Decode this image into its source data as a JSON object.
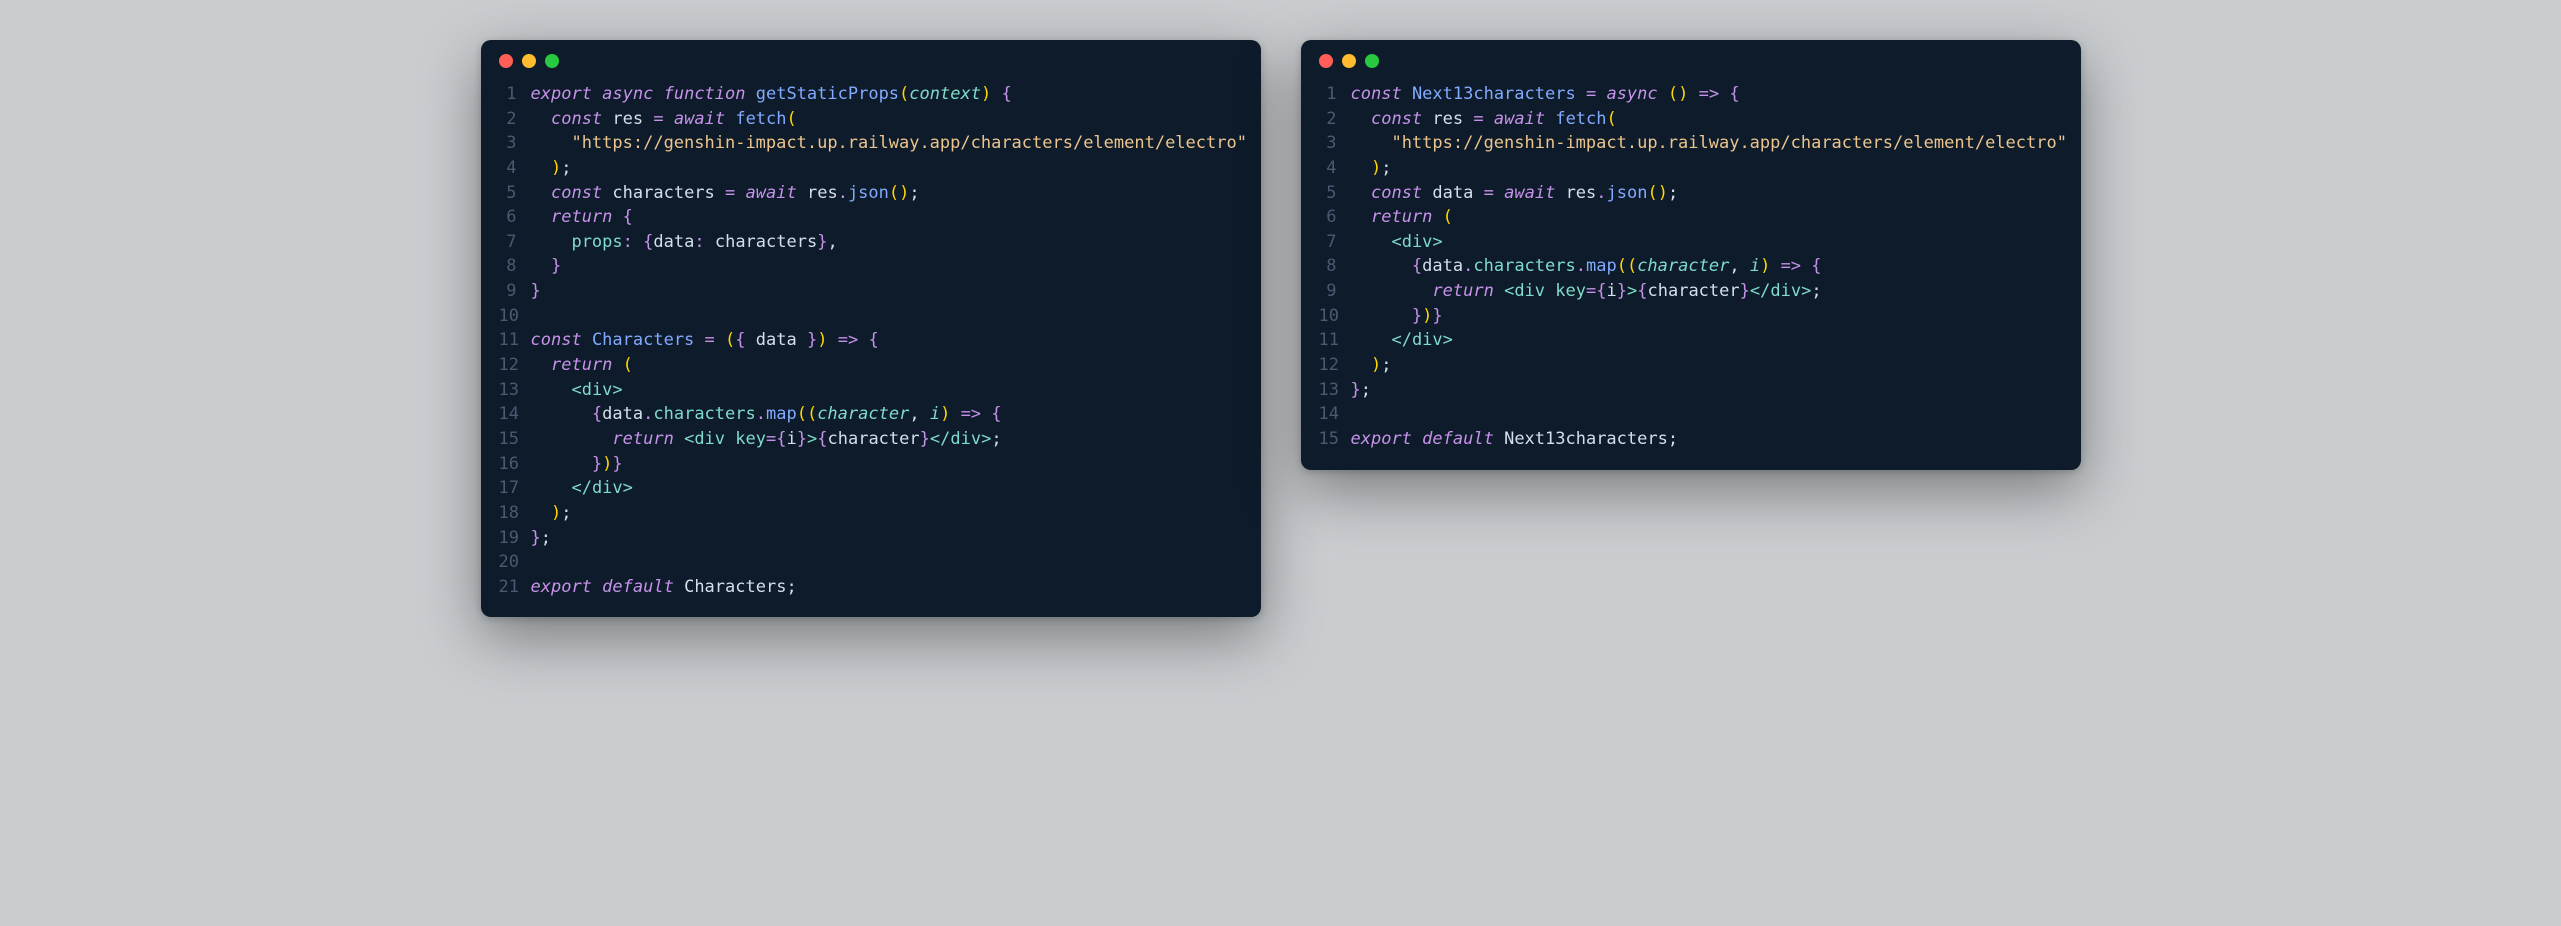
{
  "left": {
    "lines": [
      {
        "n": "1",
        "tokens": [
          [
            "kw",
            "export"
          ],
          [
            "white",
            " "
          ],
          [
            "kw",
            "async"
          ],
          [
            "white",
            " "
          ],
          [
            "kw",
            "function"
          ],
          [
            "white",
            " "
          ],
          [
            "fn",
            "getStaticProps"
          ],
          [
            "paren",
            "("
          ],
          [
            "param",
            "context"
          ],
          [
            "paren",
            ")"
          ],
          [
            "white",
            " "
          ],
          [
            "punc",
            "{"
          ]
        ]
      },
      {
        "n": "2",
        "tokens": [
          [
            "white",
            "  "
          ],
          [
            "kw",
            "const"
          ],
          [
            "white",
            " "
          ],
          [
            "var",
            "res"
          ],
          [
            "white",
            " "
          ],
          [
            "op",
            "="
          ],
          [
            "white",
            " "
          ],
          [
            "kw",
            "await"
          ],
          [
            "white",
            " "
          ],
          [
            "fn",
            "fetch"
          ],
          [
            "paren",
            "("
          ]
        ]
      },
      {
        "n": "3",
        "tokens": [
          [
            "white",
            "    "
          ],
          [
            "str",
            "\"https://genshin-impact.up.railway.app/characters/element/electro\""
          ]
        ]
      },
      {
        "n": "4",
        "tokens": [
          [
            "white",
            "  "
          ],
          [
            "paren",
            ")"
          ],
          [
            "semi",
            ";"
          ]
        ]
      },
      {
        "n": "5",
        "tokens": [
          [
            "white",
            "  "
          ],
          [
            "kw",
            "const"
          ],
          [
            "white",
            " "
          ],
          [
            "var",
            "characters"
          ],
          [
            "white",
            " "
          ],
          [
            "op",
            "="
          ],
          [
            "white",
            " "
          ],
          [
            "kw",
            "await"
          ],
          [
            "white",
            " "
          ],
          [
            "var",
            "res"
          ],
          [
            "dot2",
            "."
          ],
          [
            "fn",
            "json"
          ],
          [
            "paren",
            "()"
          ],
          [
            "semi",
            ";"
          ]
        ]
      },
      {
        "n": "6",
        "tokens": [
          [
            "white",
            "  "
          ],
          [
            "kw",
            "return"
          ],
          [
            "white",
            " "
          ],
          [
            "punc",
            "{"
          ]
        ]
      },
      {
        "n": "7",
        "tokens": [
          [
            "white",
            "    "
          ],
          [
            "prop",
            "props"
          ],
          [
            "punc",
            ":"
          ],
          [
            "white",
            " "
          ],
          [
            "punc",
            "{"
          ],
          [
            "var",
            "data"
          ],
          [
            "punc",
            ":"
          ],
          [
            "white",
            " "
          ],
          [
            "var",
            "characters"
          ],
          [
            "punc",
            "}"
          ],
          [
            "semi",
            ","
          ]
        ]
      },
      {
        "n": "8",
        "tokens": [
          [
            "white",
            "  "
          ],
          [
            "punc",
            "}"
          ]
        ]
      },
      {
        "n": "9",
        "tokens": [
          [
            "punc",
            "}"
          ]
        ]
      },
      {
        "n": "10",
        "tokens": []
      },
      {
        "n": "11",
        "tokens": [
          [
            "kw",
            "const"
          ],
          [
            "white",
            " "
          ],
          [
            "fn",
            "Characters"
          ],
          [
            "white",
            " "
          ],
          [
            "op",
            "="
          ],
          [
            "white",
            " "
          ],
          [
            "paren",
            "("
          ],
          [
            "punc",
            "{"
          ],
          [
            "white",
            " "
          ],
          [
            "var",
            "data"
          ],
          [
            "white",
            " "
          ],
          [
            "punc",
            "}"
          ],
          [
            "paren",
            ")"
          ],
          [
            "white",
            " "
          ],
          [
            "op",
            "=>"
          ],
          [
            "white",
            " "
          ],
          [
            "punc",
            "{"
          ]
        ]
      },
      {
        "n": "12",
        "tokens": [
          [
            "white",
            "  "
          ],
          [
            "kw",
            "return"
          ],
          [
            "white",
            " "
          ],
          [
            "paren",
            "("
          ]
        ]
      },
      {
        "n": "13",
        "tokens": [
          [
            "white",
            "    "
          ],
          [
            "angle",
            "<"
          ],
          [
            "tag",
            "div"
          ],
          [
            "angle",
            ">"
          ]
        ]
      },
      {
        "n": "14",
        "tokens": [
          [
            "white",
            "      "
          ],
          [
            "jsxbrace",
            "{"
          ],
          [
            "var",
            "data"
          ],
          [
            "dot2",
            "."
          ],
          [
            "prop",
            "characters"
          ],
          [
            "dot2",
            "."
          ],
          [
            "fn",
            "map"
          ],
          [
            "paren",
            "(("
          ],
          [
            "param",
            "character"
          ],
          [
            "semi",
            ","
          ],
          [
            "white",
            " "
          ],
          [
            "param",
            "i"
          ],
          [
            "paren",
            ")"
          ],
          [
            "white",
            " "
          ],
          [
            "op",
            "=>"
          ],
          [
            "white",
            " "
          ],
          [
            "punc",
            "{"
          ]
        ]
      },
      {
        "n": "15",
        "tokens": [
          [
            "white",
            "        "
          ],
          [
            "kw",
            "return"
          ],
          [
            "white",
            " "
          ],
          [
            "angle",
            "<"
          ],
          [
            "tag",
            "div"
          ],
          [
            "white",
            " "
          ],
          [
            "prop",
            "key"
          ],
          [
            "op",
            "="
          ],
          [
            "jsxbrace",
            "{"
          ],
          [
            "var",
            "i"
          ],
          [
            "jsxbrace",
            "}"
          ],
          [
            "angle",
            ">"
          ],
          [
            "jsxbrace",
            "{"
          ],
          [
            "var",
            "character"
          ],
          [
            "jsxbrace",
            "}"
          ],
          [
            "angle",
            "</"
          ],
          [
            "tag",
            "div"
          ],
          [
            "angle",
            ">"
          ],
          [
            "semi",
            ";"
          ]
        ]
      },
      {
        "n": "16",
        "tokens": [
          [
            "white",
            "      "
          ],
          [
            "punc",
            "}"
          ],
          [
            "paren",
            ")"
          ],
          [
            "jsxbrace",
            "}"
          ]
        ]
      },
      {
        "n": "17",
        "tokens": [
          [
            "white",
            "    "
          ],
          [
            "angle",
            "</"
          ],
          [
            "tag",
            "div"
          ],
          [
            "angle",
            ">"
          ]
        ]
      },
      {
        "n": "18",
        "tokens": [
          [
            "white",
            "  "
          ],
          [
            "paren",
            ")"
          ],
          [
            "semi",
            ";"
          ]
        ]
      },
      {
        "n": "19",
        "tokens": [
          [
            "punc",
            "}"
          ],
          [
            "semi",
            ";"
          ]
        ]
      },
      {
        "n": "20",
        "tokens": []
      },
      {
        "n": "21",
        "tokens": [
          [
            "kw",
            "export"
          ],
          [
            "white",
            " "
          ],
          [
            "kw",
            "default"
          ],
          [
            "white",
            " "
          ],
          [
            "var",
            "Characters"
          ],
          [
            "semi",
            ";"
          ]
        ]
      }
    ]
  },
  "right": {
    "lines": [
      {
        "n": "1",
        "tokens": [
          [
            "kw",
            "const"
          ],
          [
            "white",
            " "
          ],
          [
            "fn",
            "Next13characters"
          ],
          [
            "white",
            " "
          ],
          [
            "op",
            "="
          ],
          [
            "white",
            " "
          ],
          [
            "kw",
            "async"
          ],
          [
            "white",
            " "
          ],
          [
            "paren",
            "()"
          ],
          [
            "white",
            " "
          ],
          [
            "op",
            "=>"
          ],
          [
            "white",
            " "
          ],
          [
            "punc",
            "{"
          ]
        ]
      },
      {
        "n": "2",
        "tokens": [
          [
            "white",
            "  "
          ],
          [
            "kw",
            "const"
          ],
          [
            "white",
            " "
          ],
          [
            "var",
            "res"
          ],
          [
            "white",
            " "
          ],
          [
            "op",
            "="
          ],
          [
            "white",
            " "
          ],
          [
            "kw",
            "await"
          ],
          [
            "white",
            " "
          ],
          [
            "fn",
            "fetch"
          ],
          [
            "paren",
            "("
          ]
        ]
      },
      {
        "n": "3",
        "tokens": [
          [
            "white",
            "    "
          ],
          [
            "str",
            "\"https://genshin-impact.up.railway.app/characters/element/electro\""
          ]
        ]
      },
      {
        "n": "4",
        "tokens": [
          [
            "white",
            "  "
          ],
          [
            "paren",
            ")"
          ],
          [
            "semi",
            ";"
          ]
        ]
      },
      {
        "n": "5",
        "tokens": [
          [
            "white",
            "  "
          ],
          [
            "kw",
            "const"
          ],
          [
            "white",
            " "
          ],
          [
            "var",
            "data"
          ],
          [
            "white",
            " "
          ],
          [
            "op",
            "="
          ],
          [
            "white",
            " "
          ],
          [
            "kw",
            "await"
          ],
          [
            "white",
            " "
          ],
          [
            "var",
            "res"
          ],
          [
            "dot2",
            "."
          ],
          [
            "fn",
            "json"
          ],
          [
            "paren",
            "()"
          ],
          [
            "semi",
            ";"
          ]
        ]
      },
      {
        "n": "6",
        "tokens": [
          [
            "white",
            "  "
          ],
          [
            "kw",
            "return"
          ],
          [
            "white",
            " "
          ],
          [
            "paren",
            "("
          ]
        ]
      },
      {
        "n": "7",
        "tokens": [
          [
            "white",
            "    "
          ],
          [
            "angle",
            "<"
          ],
          [
            "tag",
            "div"
          ],
          [
            "angle",
            ">"
          ]
        ]
      },
      {
        "n": "8",
        "tokens": [
          [
            "white",
            "      "
          ],
          [
            "jsxbrace",
            "{"
          ],
          [
            "var",
            "data"
          ],
          [
            "dot2",
            "."
          ],
          [
            "prop",
            "characters"
          ],
          [
            "dot2",
            "."
          ],
          [
            "fn",
            "map"
          ],
          [
            "paren",
            "(("
          ],
          [
            "param",
            "character"
          ],
          [
            "semi",
            ","
          ],
          [
            "white",
            " "
          ],
          [
            "param",
            "i"
          ],
          [
            "paren",
            ")"
          ],
          [
            "white",
            " "
          ],
          [
            "op",
            "=>"
          ],
          [
            "white",
            " "
          ],
          [
            "punc",
            "{"
          ]
        ]
      },
      {
        "n": "9",
        "tokens": [
          [
            "white",
            "        "
          ],
          [
            "kw",
            "return"
          ],
          [
            "white",
            " "
          ],
          [
            "angle",
            "<"
          ],
          [
            "tag",
            "div"
          ],
          [
            "white",
            " "
          ],
          [
            "prop",
            "key"
          ],
          [
            "op",
            "="
          ],
          [
            "jsxbrace",
            "{"
          ],
          [
            "var",
            "i"
          ],
          [
            "jsxbrace",
            "}"
          ],
          [
            "angle",
            ">"
          ],
          [
            "jsxbrace",
            "{"
          ],
          [
            "var",
            "character"
          ],
          [
            "jsxbrace",
            "}"
          ],
          [
            "angle",
            "</"
          ],
          [
            "tag",
            "div"
          ],
          [
            "angle",
            ">"
          ],
          [
            "semi",
            ";"
          ]
        ]
      },
      {
        "n": "10",
        "tokens": [
          [
            "white",
            "      "
          ],
          [
            "punc",
            "}"
          ],
          [
            "paren",
            ")"
          ],
          [
            "jsxbrace",
            "}"
          ]
        ]
      },
      {
        "n": "11",
        "tokens": [
          [
            "white",
            "    "
          ],
          [
            "angle",
            "</"
          ],
          [
            "tag",
            "div"
          ],
          [
            "angle",
            ">"
          ]
        ]
      },
      {
        "n": "12",
        "tokens": [
          [
            "white",
            "  "
          ],
          [
            "paren",
            ")"
          ],
          [
            "semi",
            ";"
          ]
        ]
      },
      {
        "n": "13",
        "tokens": [
          [
            "punc",
            "}"
          ],
          [
            "semi",
            ";"
          ]
        ]
      },
      {
        "n": "14",
        "tokens": []
      },
      {
        "n": "15",
        "tokens": [
          [
            "kw",
            "export"
          ],
          [
            "white",
            " "
          ],
          [
            "kw",
            "default"
          ],
          [
            "white",
            " "
          ],
          [
            "var",
            "Next13characters"
          ],
          [
            "semi",
            ";"
          ]
        ]
      }
    ]
  }
}
